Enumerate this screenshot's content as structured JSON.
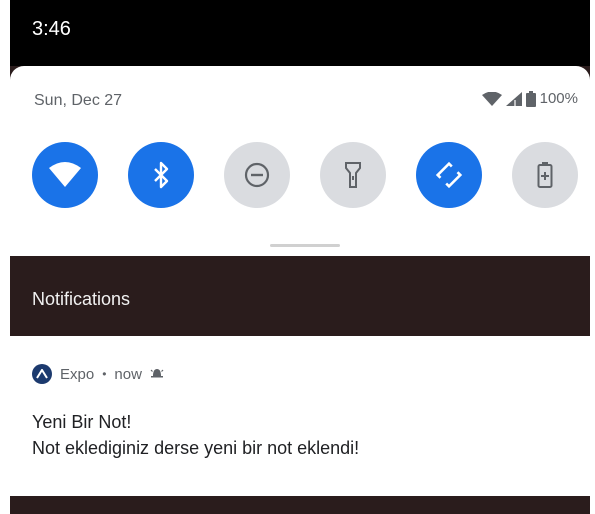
{
  "status_bar": {
    "time": "3:46"
  },
  "quick_settings": {
    "date": "Sun, Dec 27",
    "battery": "100%",
    "tiles": [
      {
        "icon": "wifi-icon",
        "state": "on"
      },
      {
        "icon": "bluetooth-icon",
        "state": "on"
      },
      {
        "icon": "do-not-disturb-icon",
        "state": "off"
      },
      {
        "icon": "flashlight-icon",
        "state": "off"
      },
      {
        "icon": "auto-rotate-icon",
        "state": "on"
      },
      {
        "icon": "battery-saver-icon",
        "state": "off"
      }
    ],
    "colors": {
      "active": "#1a73e8",
      "inactive": "#dadce0"
    }
  },
  "notifications": {
    "header": "Notifications",
    "items": [
      {
        "app": "Expo",
        "separator": "•",
        "time": "now",
        "title": "Yeni Bir Not!",
        "body": "Not eklediginiz derse yeni bir not eklendi!"
      }
    ]
  }
}
